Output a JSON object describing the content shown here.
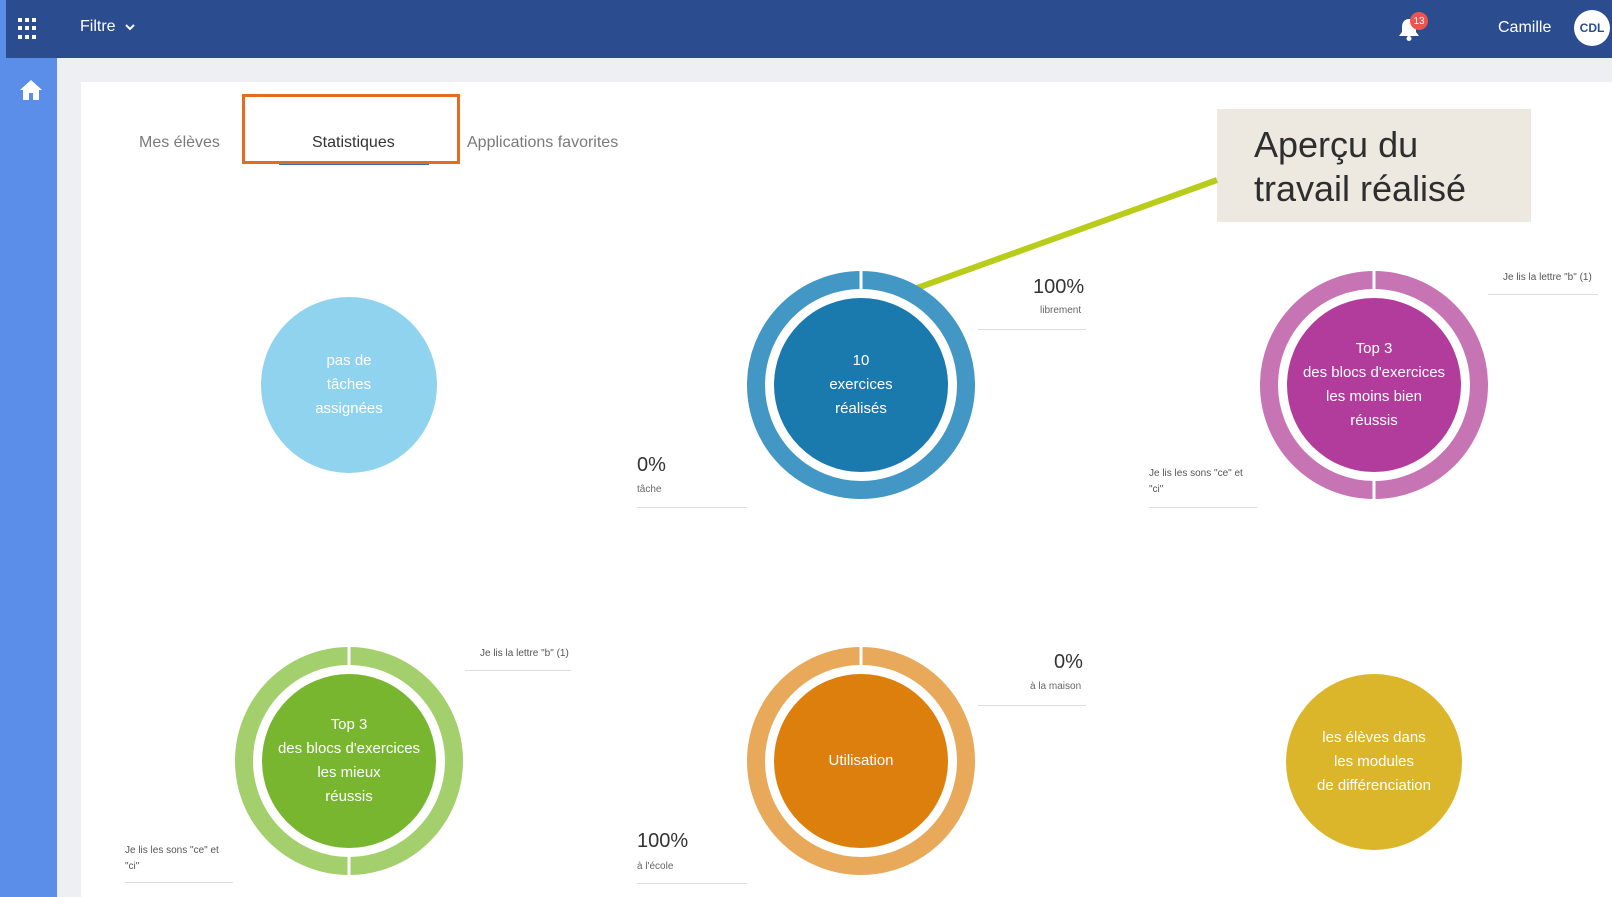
{
  "topbar": {
    "filter_label": "Filtre",
    "notification_count": "13",
    "username": "Camille",
    "avatar_initials": "CDL"
  },
  "tabs": [
    {
      "label": "Mes élèves",
      "active": false
    },
    {
      "label": "Statistiques",
      "active": true
    },
    {
      "label": "Applications favorites",
      "active": false
    }
  ],
  "callout": {
    "line1": "Aperçu du",
    "line2": "travail réalisé"
  },
  "stats": {
    "no_tasks": {
      "line1": "pas de",
      "line2": "tâches",
      "line3": "assignées",
      "color": "#8fd3ef"
    },
    "exercises": {
      "line1": "10",
      "line2": "exercices",
      "line3": "réalisés",
      "color": "#1a7aad",
      "ring_color": "#4397c4",
      "pct_free": "100%",
      "pct_free_label": "librement",
      "pct_task": "0%",
      "pct_task_label": "tâche"
    },
    "least_successful": {
      "line1": "Top 3",
      "line2": "des blocs d'exercices",
      "line3": "les moins bien",
      "line4": "réussis",
      "color": "#b23c9c",
      "ring_color": "#c774b5",
      "item_a": "Je lis la lettre \"b\" (1)",
      "item_b_1": "Je lis les sons \"ce\" et",
      "item_b_2": "\"ci\""
    },
    "most_successful": {
      "line1": "Top 3",
      "line2": "des blocs d'exercices",
      "line3": "les mieux",
      "line4": "réussis",
      "color": "#78b630",
      "ring_color": "#a3cf6c",
      "item_a": "Je lis la lettre \"b\" (1)",
      "item_b_1": "Je lis les sons \"ce\" et",
      "item_b_2": "\"ci\""
    },
    "usage": {
      "label": "Utilisation",
      "color": "#dd7f0d",
      "ring_color": "#e8a95a",
      "pct_home": "0%",
      "pct_home_label": "à la maison",
      "pct_school": "100%",
      "pct_school_label": "à l'école"
    },
    "differentiation": {
      "line1": "les élèves dans",
      "line2": "les modules",
      "line3": "de différenciation",
      "color": "#dcb62a"
    }
  },
  "icons": [
    "apps-grid-icon",
    "chevron-down-icon",
    "bell-icon",
    "home-icon"
  ],
  "colors": {
    "topbar": "#2b4d8f",
    "sidebar": "#5b8ee8",
    "highlight": "#e66a1f",
    "callout_arrow": "#b9cc1a"
  }
}
